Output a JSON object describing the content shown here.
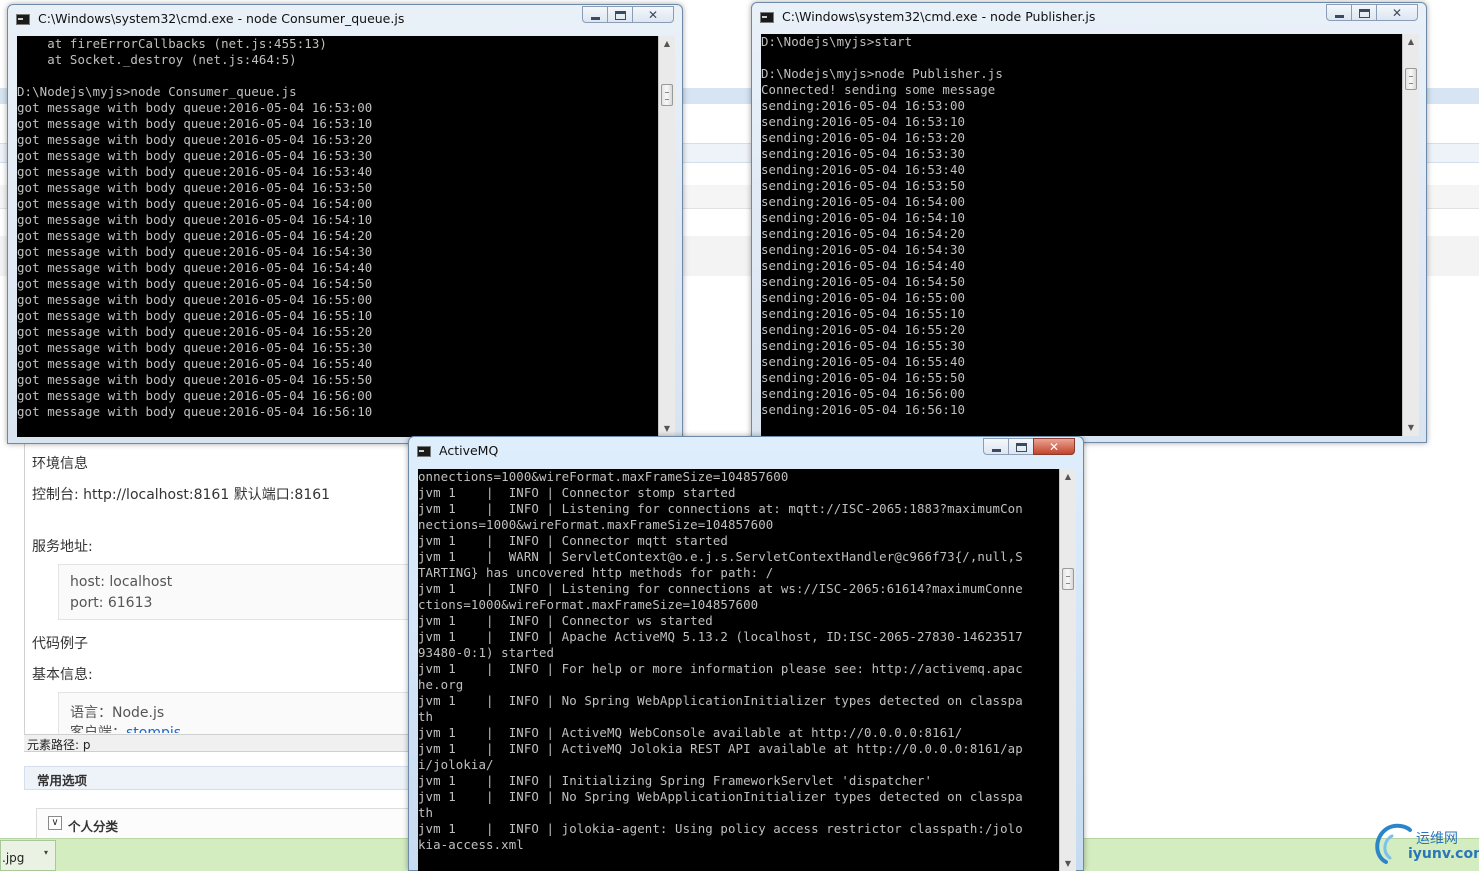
{
  "background_page": {
    "env_heading": "环境信息",
    "console_label": "控制台: http://localhost:8161 默认端口:8161",
    "service_heading": "服务地址:",
    "host_line": "host: localhost",
    "port_line": "port: 61613",
    "code_heading": "代码例子",
    "basic_heading": "基本信息:",
    "language_line": "语言：Node.js",
    "client_prefix": "客户端：",
    "client_link": "stompjs",
    "element_path": "元素路径: p",
    "common_options": "常用选项",
    "personal_category": "个人分类",
    "bottom_file": ".jpg"
  },
  "windows": {
    "consumer": {
      "title": "C:\\Windows\\system32\\cmd.exe - node  Consumer_queue.js",
      "lines": [
        "    at fireErrorCallbacks (net.js:455:13)",
        "    at Socket._destroy (net.js:464:5)",
        "",
        "D:\\Nodejs\\myjs>node Consumer_queue.js",
        "got message with body queue:2016-05-04 16:53:00",
        "got message with body queue:2016-05-04 16:53:10",
        "got message with body queue:2016-05-04 16:53:20",
        "got message with body queue:2016-05-04 16:53:30",
        "got message with body queue:2016-05-04 16:53:40",
        "got message with body queue:2016-05-04 16:53:50",
        "got message with body queue:2016-05-04 16:54:00",
        "got message with body queue:2016-05-04 16:54:10",
        "got message with body queue:2016-05-04 16:54:20",
        "got message with body queue:2016-05-04 16:54:30",
        "got message with body queue:2016-05-04 16:54:40",
        "got message with body queue:2016-05-04 16:54:50",
        "got message with body queue:2016-05-04 16:55:00",
        "got message with body queue:2016-05-04 16:55:10",
        "got message with body queue:2016-05-04 16:55:20",
        "got message with body queue:2016-05-04 16:55:30",
        "got message with body queue:2016-05-04 16:55:40",
        "got message with body queue:2016-05-04 16:55:50",
        "got message with body queue:2016-05-04 16:56:00",
        "got message with body queue:2016-05-04 16:56:10"
      ]
    },
    "publisher": {
      "title": "C:\\Windows\\system32\\cmd.exe - node  Publisher.js",
      "lines": [
        "D:\\Nodejs\\myjs>start",
        "",
        "D:\\Nodejs\\myjs>node Publisher.js",
        "Connected! sending some message",
        "sending:2016-05-04 16:53:00",
        "sending:2016-05-04 16:53:10",
        "sending:2016-05-04 16:53:20",
        "sending:2016-05-04 16:53:30",
        "sending:2016-05-04 16:53:40",
        "sending:2016-05-04 16:53:50",
        "sending:2016-05-04 16:54:00",
        "sending:2016-05-04 16:54:10",
        "sending:2016-05-04 16:54:20",
        "sending:2016-05-04 16:54:30",
        "sending:2016-05-04 16:54:40",
        "sending:2016-05-04 16:54:50",
        "sending:2016-05-04 16:55:00",
        "sending:2016-05-04 16:55:10",
        "sending:2016-05-04 16:55:20",
        "sending:2016-05-04 16:55:30",
        "sending:2016-05-04 16:55:40",
        "sending:2016-05-04 16:55:50",
        "sending:2016-05-04 16:56:00",
        "sending:2016-05-04 16:56:10"
      ]
    },
    "activemq": {
      "title": "ActiveMQ",
      "lines": [
        "onnections=1000&wireFormat.maxFrameSize=104857600",
        "jvm 1    |  INFO | Connector stomp started",
        "jvm 1    |  INFO | Listening for connections at: mqtt://ISC-2065:1883?maximumCon",
        "nections=1000&wireFormat.maxFrameSize=104857600",
        "jvm 1    |  INFO | Connector mqtt started",
        "jvm 1    |  WARN | ServletContext@o.e.j.s.ServletContextHandler@c966f73{/,null,S",
        "TARTING} has uncovered http methods for path: /",
        "jvm 1    |  INFO | Listening for connections at ws://ISC-2065:61614?maximumConne",
        "ctions=1000&wireFormat.maxFrameSize=104857600",
        "jvm 1    |  INFO | Connector ws started",
        "jvm 1    |  INFO | Apache ActiveMQ 5.13.2 (localhost, ID:ISC-2065-27830-14623517",
        "93480-0:1) started",
        "jvm 1    |  INFO | For help or more information please see: http://activemq.apac",
        "he.org",
        "jvm 1    |  INFO | No Spring WebApplicationInitializer types detected on classpa",
        "th",
        "jvm 1    |  INFO | ActiveMQ WebConsole available at http://0.0.0.0:8161/",
        "jvm 1    |  INFO | ActiveMQ Jolokia REST API available at http://0.0.0.0:8161/ap",
        "i/jolokia/",
        "jvm 1    |  INFO | Initializing Spring FrameworkServlet 'dispatcher'",
        "jvm 1    |  INFO | No Spring WebApplicationInitializer types detected on classpa",
        "th",
        "jvm 1    |  INFO | jolokia-agent: Using policy access restrictor classpath:/jolo",
        "kia-access.xml"
      ]
    }
  },
  "controls": {
    "minimize_icon": "minimize-icon",
    "maximize_icon": "maximize-icon",
    "close_icon": "close-icon",
    "close_glyph": "✕",
    "scroll_up_glyph": "▲",
    "scroll_down_glyph": "▼"
  },
  "watermark": {
    "text_top": "运维网",
    "text_bottom": "iyunv.com"
  },
  "colors": {
    "console_bg": "#000000",
    "console_fg": "#c0c0c0",
    "link": "#1b66c9",
    "taskbar_green": "#d3ecc0"
  }
}
